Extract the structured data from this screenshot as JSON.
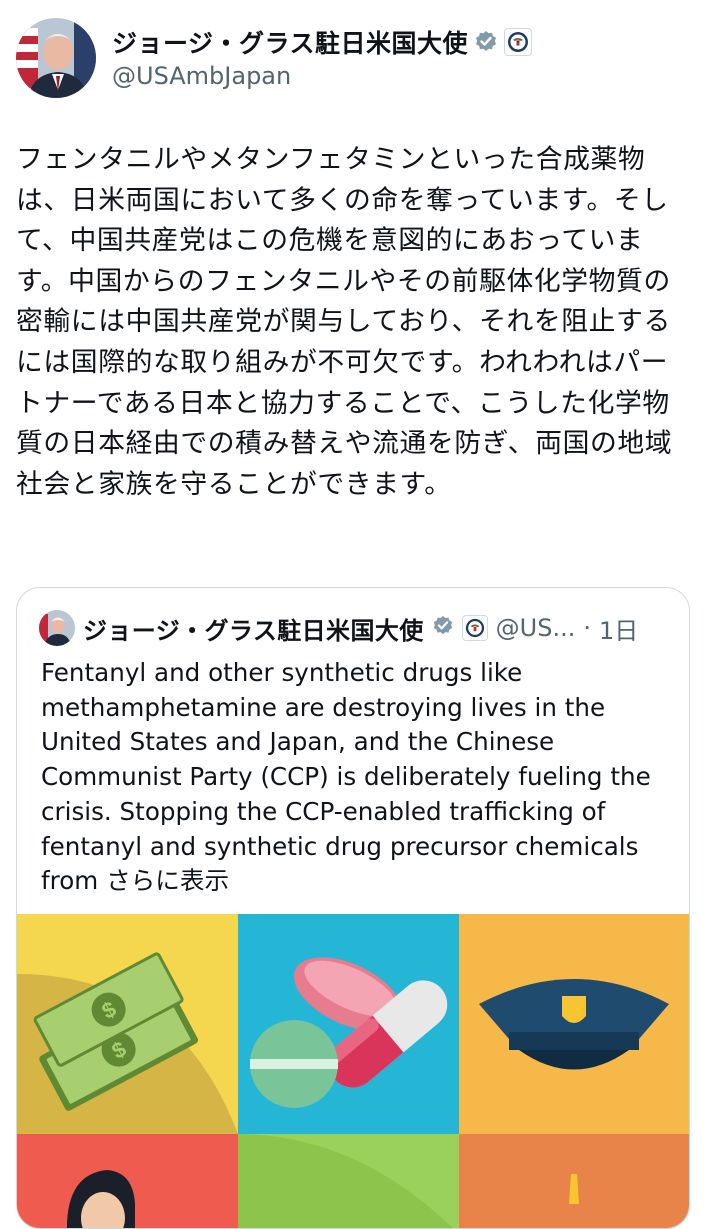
{
  "post": {
    "author": {
      "display_name": "ジョージ・グラス駐日米国大使",
      "handle": "@USAmbJapan",
      "verified_icon": "verified-badge-icon",
      "affiliate_icon": "state-department-seal-icon"
    },
    "text": "フェンタニルやメタンフェタミンといった合成薬物は、日米両国において多くの命を奪っています。そして、中国共産党はこの危機を意図的にあおっています。中国からのフェンタニルやその前駆体化学物質の密輸には中国共産党が関与しており、それを阻止するには国際的な取り組みが不可欠です。われわれはパートナーである日本と協力することで、こうした化学物質の日本経由での積み替えや流通を防ぎ、両国の地域社会と家族を守ることができます。"
  },
  "quoted_post": {
    "display_name": "ジョージ・グラス駐日米国大使",
    "handle": "@US...",
    "dot": "·",
    "time": "1日",
    "text": "Fentanyl and other synthetic drugs like methamphetamine are destroying lives in the United States and Japan, and the Chinese Communist Party (CCP) is deliberately fueling the crisis. Stopping the CCP-enabled trafficking of fentanyl and synthetic drug precursor chemicals from",
    "show_more": "さらに表示",
    "media_tiles": [
      "money-icon",
      "pills-icon",
      "police-hat-icon",
      "person-icon",
      "green-tile",
      "orange-tile"
    ]
  },
  "colors": {
    "text": "#0f1419",
    "secondary": "#536471",
    "verified_blue": "#1d9bf0",
    "border": "#cfd9de"
  }
}
